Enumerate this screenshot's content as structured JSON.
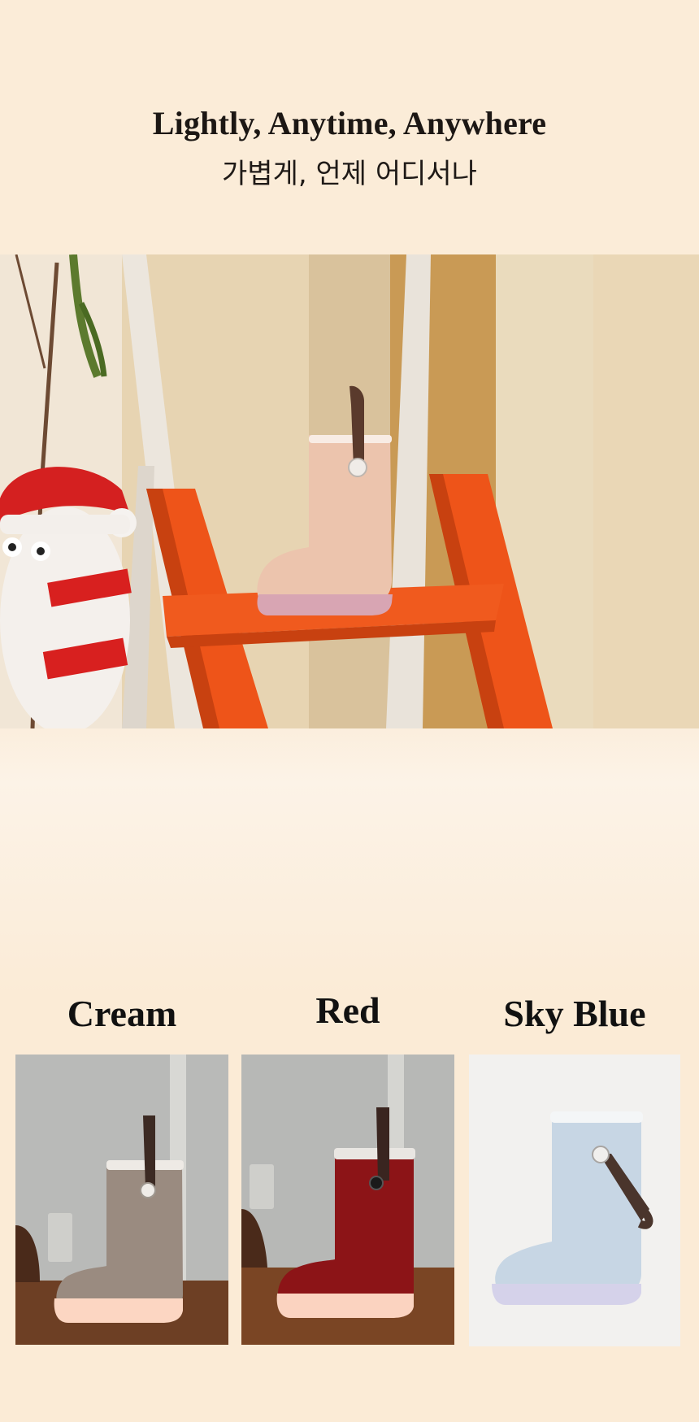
{
  "hero": {
    "title_en": "Lightly, Anytime, Anywhere",
    "title_ko": "가볍게, 언제 어디서나"
  },
  "variants": [
    {
      "label": "Cream",
      "color": "#9b8d83"
    },
    {
      "label": "Red",
      "color": "#9b1d20"
    },
    {
      "label": "Sky Blue",
      "color": "#c8d6e4"
    }
  ],
  "colors": {
    "background": "#fbebd6",
    "ladder": "#f0561a",
    "hero_boot": "#ecc5ae"
  }
}
